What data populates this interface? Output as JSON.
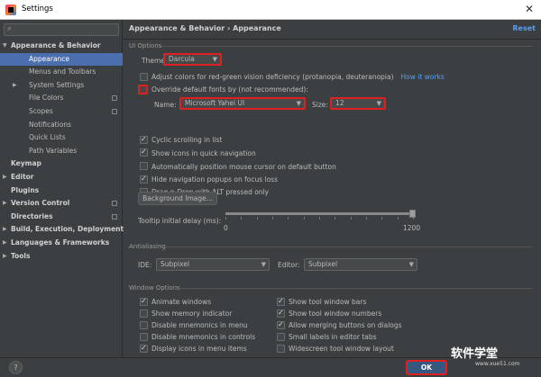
{
  "window": {
    "title": "Settings",
    "close_label": "✕",
    "help_label": "?",
    "ok_label": "OK"
  },
  "sidebar": {
    "items": [
      {
        "label": "Appearance & Behavior",
        "level": 0,
        "arrow": "▼",
        "bold": true
      },
      {
        "label": "Appearance",
        "level": 1,
        "selected": true
      },
      {
        "label": "Menus and Toolbars",
        "level": 1
      },
      {
        "label": "System Settings",
        "level": 1,
        "arrow": "▶"
      },
      {
        "label": "File Colors",
        "level": 1,
        "badge": true
      },
      {
        "label": "Scopes",
        "level": 1,
        "badge": true
      },
      {
        "label": "Notifications",
        "level": 1
      },
      {
        "label": "Quick Lists",
        "level": 1
      },
      {
        "label": "Path Variables",
        "level": 1
      },
      {
        "label": "Keymap",
        "level": 0,
        "bold": true
      },
      {
        "label": "Editor",
        "level": 0,
        "arrow": "▶",
        "bold": true
      },
      {
        "label": "Plugins",
        "level": 0,
        "bold": true
      },
      {
        "label": "Version Control",
        "level": 0,
        "arrow": "▶",
        "bold": true,
        "badge": true
      },
      {
        "label": "Directories",
        "level": 0,
        "bold": true,
        "badge": true
      },
      {
        "label": "Build, Execution, Deployment",
        "level": 0,
        "arrow": "▶",
        "bold": true
      },
      {
        "label": "Languages & Frameworks",
        "level": 0,
        "arrow": "▶",
        "bold": true
      },
      {
        "label": "Tools",
        "level": 0,
        "arrow": "▶",
        "bold": true
      }
    ]
  },
  "header": {
    "breadcrumb": "Appearance & Behavior  ›  Appearance",
    "reset_label": "Reset"
  },
  "ui_options": {
    "section_label": "UI Options",
    "theme_label": "Theme:",
    "theme_value": "Darcula",
    "adjust_colors_label": "Adjust colors for red-green vision deficiency (protanopia, deuteranopia)",
    "how_it_works_label": "How it works",
    "override_fonts_label": "Override default fonts by (not recommended):",
    "name_label": "Name:",
    "font_name_value": "Microsoft Yahei UI",
    "size_label": "Size:",
    "font_size_value": "12",
    "checkboxes": [
      {
        "label": "Cyclic scrolling in list",
        "checked": true
      },
      {
        "label": "Show icons in quick navigation",
        "checked": true
      },
      {
        "label": "Automatically position mouse cursor on default button",
        "checked": false
      },
      {
        "label": "Hide navigation popups on focus loss",
        "checked": true
      },
      {
        "label": "Drag-n-Drop with ALT pressed only",
        "checked": false
      }
    ],
    "background_image_label": "Background Image...",
    "tooltip_delay_label": "Tooltip initial delay (ms):",
    "slider_min_label": "0",
    "slider_max_label": "1200",
    "slider_value_fraction": 1.0
  },
  "antialiasing": {
    "section_label": "Antialiasing",
    "ide_label": "IDE:",
    "ide_value": "Subpixel",
    "editor_label": "Editor:",
    "editor_value": "Subpixel"
  },
  "window_options": {
    "section_label": "Window Options",
    "left": [
      {
        "label": "Animate windows",
        "checked": true
      },
      {
        "label": "Show memory indicator",
        "checked": false
      },
      {
        "label": "Disable mnemonics in menu",
        "checked": false
      },
      {
        "label": "Disable mnemonics in controls",
        "checked": false
      },
      {
        "label": "Display icons in menu items",
        "checked": true
      }
    ],
    "right": [
      {
        "label": "Show tool window bars",
        "checked": true
      },
      {
        "label": "Show tool window numbers",
        "checked": true
      },
      {
        "label": "Allow merging buttons on dialogs",
        "checked": true
      },
      {
        "label": "Small labels in editor tabs",
        "checked": false
      },
      {
        "label": "Widescreen tool window layout",
        "checked": false
      }
    ]
  },
  "watermark": {
    "text": "软件学堂",
    "sub_text": "www.xue51.com"
  },
  "colors": {
    "accent": "#4b6eaf",
    "link": "#589df6",
    "highlight": "#e02020",
    "background": "#3c3f41"
  }
}
